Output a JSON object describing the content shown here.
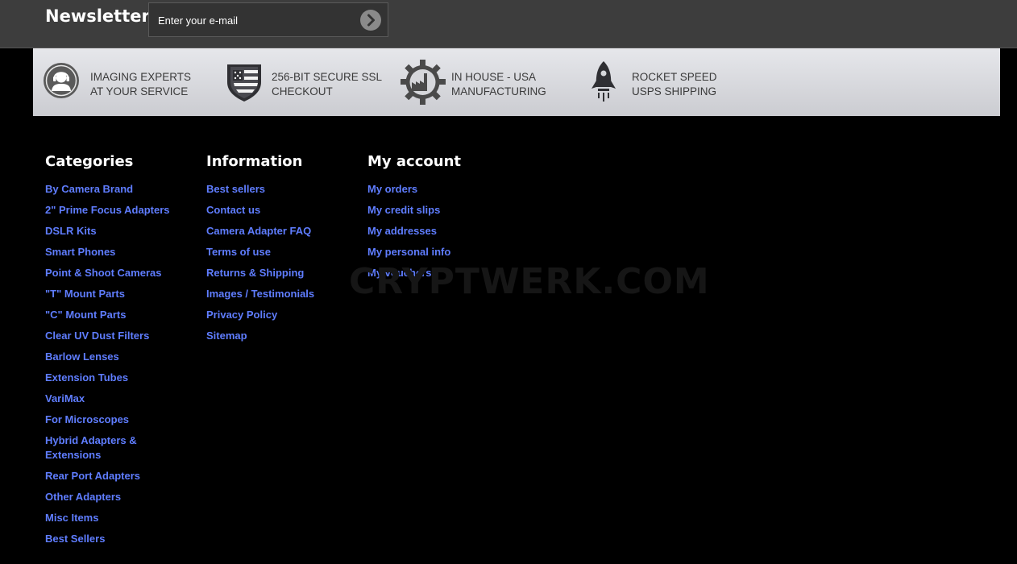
{
  "newsletter": {
    "title": "Newsletter",
    "email_placeholder": "Enter your e-mail",
    "submit_icon": "chevron-right-circle-icon"
  },
  "features": [
    {
      "icon": "headset-support-icon",
      "line1": "IMAGING EXPERTS",
      "line2": "AT YOUR SERVICE"
    },
    {
      "icon": "flag-shield-icon",
      "line1": "256-BIT SECURE SSL",
      "line2": "CHECKOUT"
    },
    {
      "icon": "factory-gear-icon",
      "line1": "IN HOUSE - USA",
      "line2": "MANUFACTURING"
    },
    {
      "icon": "rocket-icon",
      "line1": "ROCKET SPEED",
      "line2": "USPS SHIPPING"
    }
  ],
  "colors": {
    "link": "#5f7dff",
    "newsletter_bg": "#3d3d3d",
    "feature_text": "#3a3a3a",
    "page_bg": "#000000"
  },
  "footer": {
    "categories": {
      "title": "Categories",
      "items": [
        "By Camera Brand",
        "2\" Prime Focus Adapters",
        "DSLR Kits",
        "Smart Phones",
        "Point & Shoot Cameras",
        "\"T\" Mount Parts",
        "\"C\" Mount Parts",
        "Clear UV Dust Filters",
        "Barlow Lenses",
        "Extension Tubes",
        "VariMax",
        "For Microscopes",
        "Hybrid Adapters & Extensions",
        "Rear Port Adapters",
        "Other Adapters",
        "Misc Items",
        "Best Sellers"
      ]
    },
    "information": {
      "title": "Information",
      "items": [
        "Best sellers",
        "Contact us",
        "Camera Adapter FAQ",
        "Terms of use",
        "Returns & Shipping",
        "Images / Testimonials",
        "Privacy Policy",
        "Sitemap"
      ]
    },
    "account": {
      "title": "My account",
      "items": [
        "My orders",
        "My credit slips",
        "My addresses",
        "My personal info",
        "My vouchers"
      ]
    }
  },
  "watermark": "CRYPTWERK.COM"
}
